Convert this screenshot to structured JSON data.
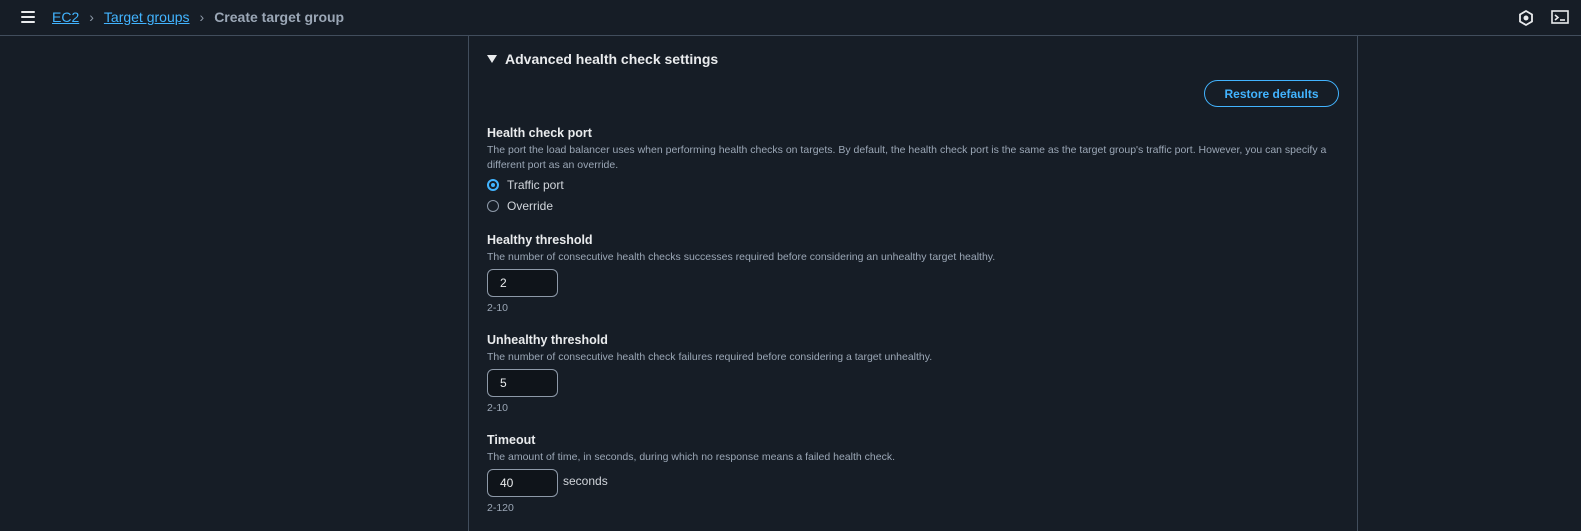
{
  "breadcrumb": {
    "items": [
      "EC2",
      "Target groups"
    ],
    "current": "Create target group"
  },
  "section": {
    "title": "Advanced health check settings",
    "restore_label": "Restore defaults"
  },
  "health_check_port": {
    "label": "Health check port",
    "description": "The port the load balancer uses when performing health checks on targets. By default, the health check port is the same as the target group's traffic port. However, you can specify a different port as an override.",
    "options": [
      "Traffic port",
      "Override"
    ],
    "selected": "Traffic port"
  },
  "healthy_threshold": {
    "label": "Healthy threshold",
    "description": "The number of consecutive health checks successes required before considering an unhealthy target healthy.",
    "value": "2",
    "hint": "2-10"
  },
  "unhealthy_threshold": {
    "label": "Unhealthy threshold",
    "description": "The number of consecutive health check failures required before considering a target unhealthy.",
    "value": "5",
    "hint": "2-10"
  },
  "timeout": {
    "label": "Timeout",
    "description": "The amount of time, in seconds, during which no response means a failed health check.",
    "value": "40",
    "unit": "seconds",
    "hint": "2-120"
  },
  "colors": {
    "accent": "#42b4ff",
    "background": "#161d26"
  }
}
